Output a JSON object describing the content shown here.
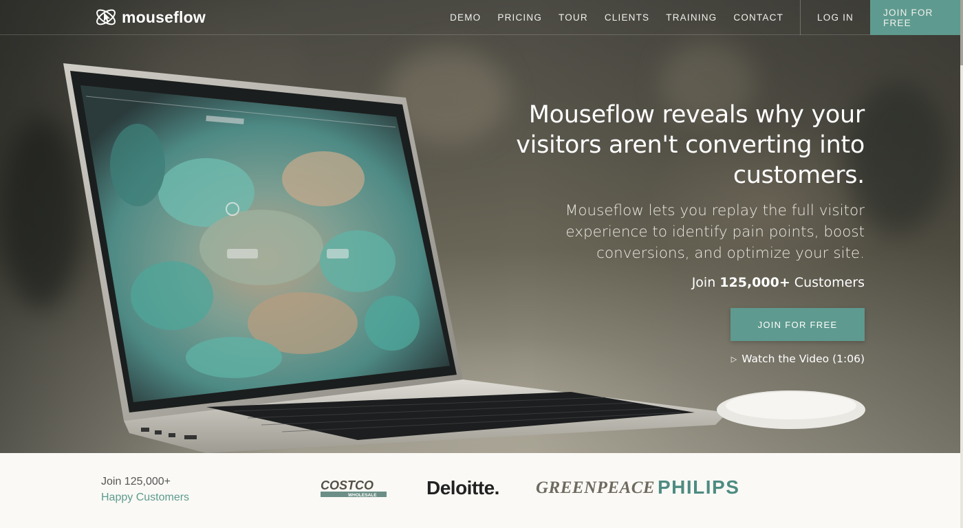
{
  "brand": {
    "name": "mouseflow",
    "accent": "#5e9a8f"
  },
  "nav": {
    "items": [
      "DEMO",
      "PRICING",
      "TOUR",
      "CLIENTS",
      "TRAINING",
      "CONTACT"
    ],
    "login": "LOG IN",
    "join": "JOIN FOR FREE"
  },
  "hero": {
    "headline_l1": "Mouseflow reveals why your",
    "headline_l2": "visitors aren't converting into",
    "headline_l3": "customers.",
    "sub_l1": "Mouseflow lets you replay the full visitor",
    "sub_l2": "experience to identify pain points, boost",
    "sub_l3": "conversions, and optimize your site.",
    "join_prefix": "Join ",
    "join_count": "125,000+",
    "join_suffix": " Customers",
    "cta": "JOIN FOR FREE",
    "video_icon": "play-icon",
    "video": "Watch the Video (1:06)"
  },
  "customers": {
    "line1": "Join 125,000+",
    "line2": "Happy Customers",
    "logos": {
      "costco_top": "COSTCO",
      "costco_bottom": "WHOLESALE",
      "deloitte": "Deloitte.",
      "greenpeace": "GREENPEACE",
      "philips": "PHILIPS"
    }
  }
}
